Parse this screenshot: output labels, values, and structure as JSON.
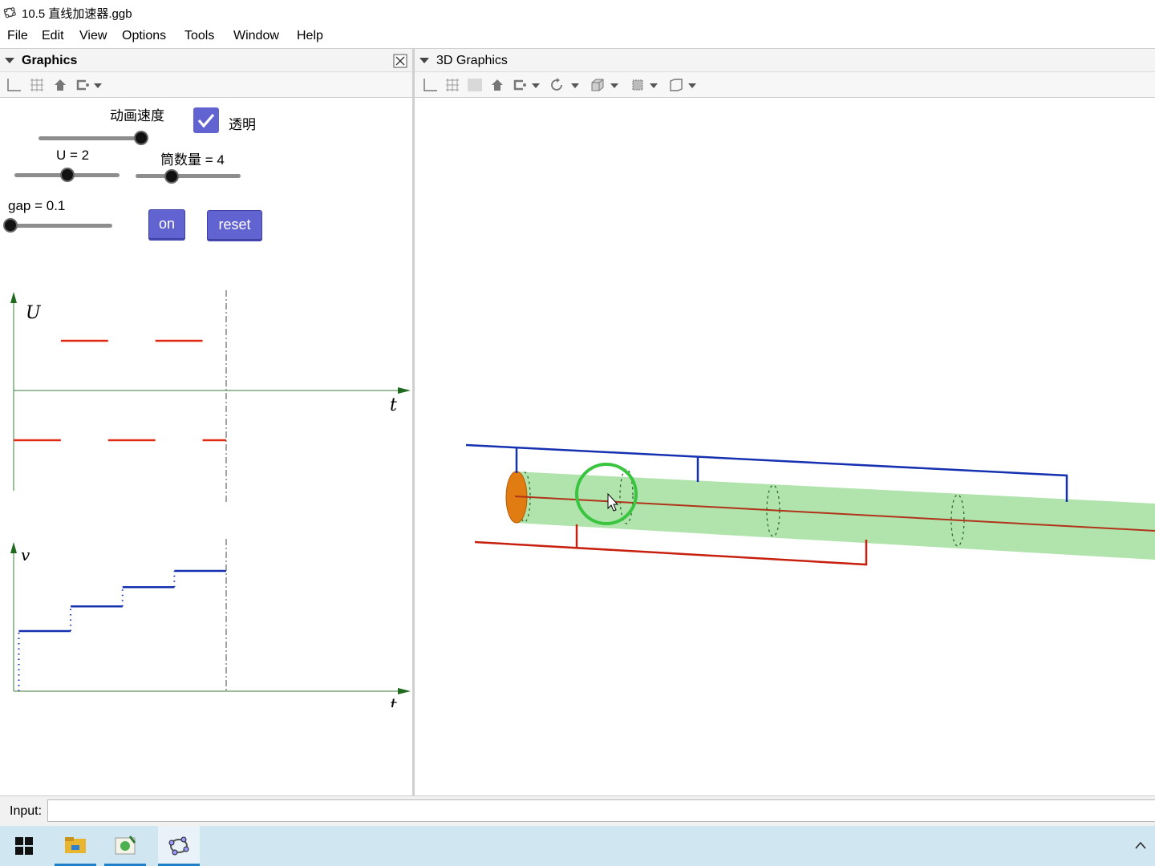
{
  "window": {
    "title": "10.5 直线加速器.ggb",
    "app_icon": "geogebra-icon"
  },
  "menu": [
    "File",
    "Edit",
    "View",
    "Options",
    "Tools",
    "Window",
    "Help"
  ],
  "graphics_panel": {
    "title": "Graphics",
    "speed_label": "动画速度",
    "speed_value": 1.0,
    "transparent_label": "透明",
    "transparent_checked": true,
    "u_label": "U = 2",
    "u_value": 2,
    "tubes_label": "筒数量 = 4",
    "tubes_value": 4,
    "gap_label": "gap = 0.1",
    "gap_value": 0.1,
    "on_button": "on",
    "reset_button": "reset",
    "colors": {
      "button": "#6163d0",
      "voltage": "#e02a14",
      "velocity": "#1530b0",
      "axis": "#3b7d3b"
    }
  },
  "chart_data": [
    {
      "type": "line",
      "ylabel": "U",
      "xlabel": "t",
      "series": [
        {
          "values": [
            [
              0,
              -1
            ],
            [
              1,
              -1
            ]
          ]
        },
        {
          "values": [
            [
              1,
              1
            ],
            [
              2,
              1
            ]
          ]
        },
        {
          "values": [
            [
              2,
              -1
            ],
            [
              3,
              -1
            ]
          ]
        },
        {
          "values": [
            [
              3,
              1
            ],
            [
              4,
              1
            ]
          ]
        },
        {
          "values": [
            [
              4,
              -1
            ],
            [
              4.5,
              -1
            ]
          ]
        }
      ],
      "cursor_t": 4.5
    },
    {
      "type": "line",
      "ylabel": "v",
      "xlabel": "t",
      "series": [
        {
          "values": [
            [
              0.1,
              1
            ],
            [
              1.1,
              1
            ]
          ]
        },
        {
          "values": [
            [
              1.1,
              1.41
            ],
            [
              2.1,
              1.41
            ]
          ]
        },
        {
          "values": [
            [
              2.1,
              1.73
            ],
            [
              3.1,
              1.73
            ]
          ]
        },
        {
          "values": [
            [
              3.1,
              2
            ],
            [
              4.1,
              2
            ]
          ]
        }
      ],
      "cursor_t": 4.1
    }
  ],
  "graphics3d_panel": {
    "title": "3D Graphics"
  },
  "input_bar": {
    "label": "Input:",
    "value": ""
  }
}
